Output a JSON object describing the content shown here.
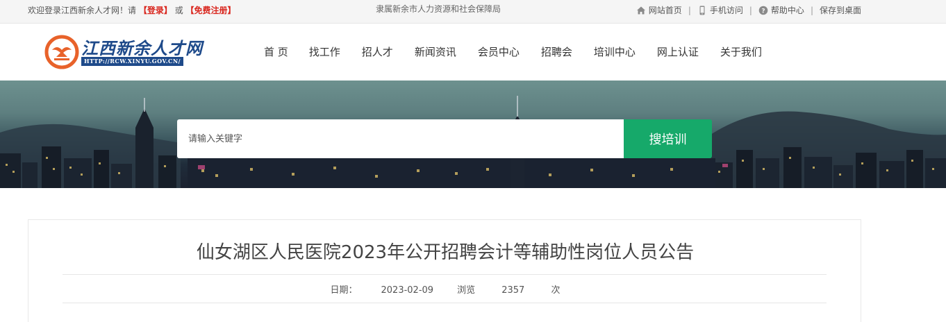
{
  "topbar": {
    "welcome": "欢迎登录江西新余人才网！请",
    "login": "【登录】",
    "or": "或",
    "register": "【免费注册】",
    "agency": "隶属新余市人力资源和社会保障局",
    "links": [
      {
        "label": "网站首页",
        "icon": "home-icon"
      },
      {
        "label": "手机访问",
        "icon": "mobile-icon"
      },
      {
        "label": "帮助中心",
        "icon": "help-icon"
      },
      {
        "label": "保存到桌面",
        "icon": ""
      }
    ],
    "separator": "|"
  },
  "header": {
    "logo_title": "江西新余人才网",
    "logo_url": "HTTP://RCW.XINYU.GOV.CN/",
    "logo_colors": {
      "orange": "#e8622a",
      "blue": "#1e4a8a"
    }
  },
  "nav": {
    "items": [
      "首 页",
      "找工作",
      "招人才",
      "新闻资讯",
      "会员中心",
      "招聘会",
      "培训中心",
      "网上认证",
      "关于我们"
    ]
  },
  "search": {
    "placeholder": "请输入关键字",
    "button_label": "搜培训",
    "button_color": "#16a96a"
  },
  "article": {
    "title": "仙女湖区人民医院2023年公开招聘会计等辅助性岗位人员公告",
    "date_label": "日期：",
    "date": "2023-02-09",
    "views_label": "浏览",
    "views": "2357",
    "views_unit": "次"
  }
}
